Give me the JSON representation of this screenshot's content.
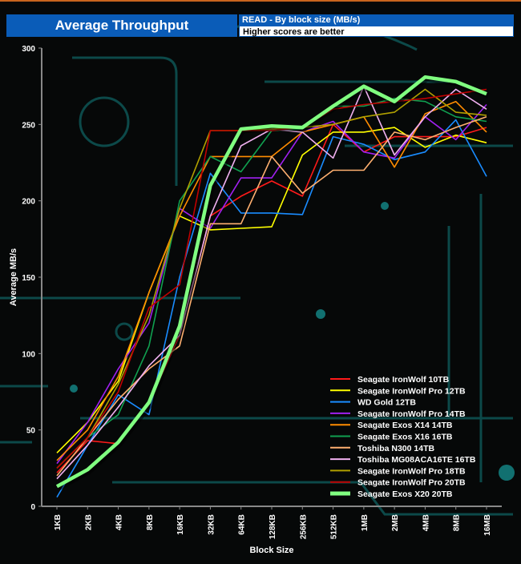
{
  "header": {
    "title": "Average Throughput",
    "subtitle": "READ - By block size (MB/s)",
    "note": "Higher scores are better"
  },
  "chart_data": {
    "type": "line",
    "title": "Average Throughput",
    "subtitle": "READ - By block size (MB/s)",
    "xlabel": "Block Size",
    "ylabel": "Average MB/s",
    "ylim": [
      0,
      300
    ],
    "yticks": [
      0,
      50,
      100,
      150,
      200,
      250,
      300
    ],
    "categories": [
      "1KB",
      "2KB",
      "4KB",
      "8KB",
      "16KB",
      "32KB",
      "64KB",
      "128KB",
      "256KB",
      "512KB",
      "1MB",
      "2MB",
      "4MB",
      "8MB",
      "16MB"
    ],
    "legend_position": "bottom-right",
    "series": [
      {
        "name": "Seagate IronWolf 10TB",
        "color": "#ff1a1a",
        "values": [
          22,
          43,
          41,
          68,
          112,
          190,
          203,
          213,
          203,
          250,
          232,
          242,
          242,
          242,
          248
        ]
      },
      {
        "name": "Seagate IronWolf Pro 12TB",
        "color": "#ffff00",
        "values": [
          35,
          55,
          82,
          140,
          190,
          181,
          182,
          183,
          230,
          245,
          245,
          248,
          235,
          243,
          238
        ]
      },
      {
        "name": "WD Gold 12TB",
        "color": "#1a8cff",
        "values": [
          6,
          40,
          73,
          60,
          150,
          218,
          192,
          192,
          191,
          242,
          237,
          227,
          232,
          253,
          216
        ]
      },
      {
        "name": "Seagate IronWolf Pro 14TB",
        "color": "#a020f0",
        "values": [
          28,
          55,
          90,
          120,
          195,
          182,
          215,
          215,
          245,
          252,
          232,
          228,
          255,
          240,
          263
        ]
      },
      {
        "name": "Seagate Exos X14 14TB",
        "color": "#ff8c00",
        "values": [
          30,
          50,
          85,
          140,
          190,
          229,
          229,
          229,
          245,
          250,
          255,
          222,
          257,
          265,
          245
        ]
      },
      {
        "name": "Seagate Exos X16 16TB",
        "color": "#10a050",
        "values": [
          25,
          45,
          60,
          105,
          200,
          229,
          219,
          246,
          247,
          262,
          262,
          267,
          265,
          255,
          252
        ]
      },
      {
        "name": "Toshiba N300 14TB",
        "color": "#ffb070",
        "values": [
          20,
          45,
          70,
          90,
          105,
          185,
          185,
          229,
          205,
          220,
          220,
          245,
          240,
          248,
          255
        ]
      },
      {
        "name": "Toshiba MG08ACA16TE 16TB",
        "color": "#f0b0f0",
        "values": [
          18,
          40,
          65,
          92,
          112,
          190,
          236,
          247,
          245,
          228,
          275,
          230,
          255,
          273,
          260
        ]
      },
      {
        "name": "Seagate IronWolf Pro 18TB",
        "color": "#b0a000",
        "values": [
          25,
          45,
          80,
          125,
          195,
          246,
          246,
          247,
          248,
          250,
          255,
          258,
          273,
          258,
          256
        ]
      },
      {
        "name": "Seagate IronWolf Pro 20TB",
        "color": "#c00000",
        "values": [
          25,
          45,
          75,
          130,
          145,
          246,
          246,
          246,
          248,
          260,
          263,
          265,
          267,
          270,
          273
        ]
      },
      {
        "name": "Seagate Exos X20 20TB",
        "color": "#80ff80",
        "highlight": true,
        "values": [
          13,
          24,
          42,
          68,
          118,
          210,
          247,
          249,
          248,
          262,
          275,
          265,
          281,
          278,
          270
        ]
      }
    ]
  }
}
